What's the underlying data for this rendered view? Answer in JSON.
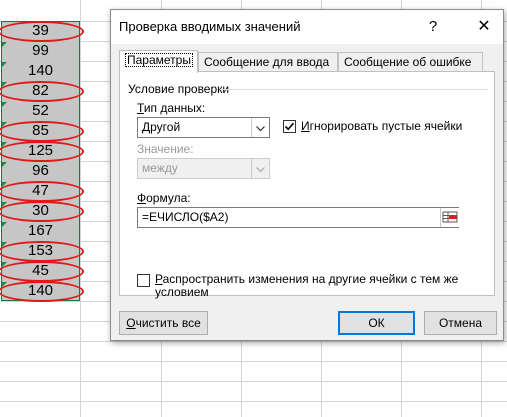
{
  "sheet": {
    "values": [
      "39",
      "99",
      "140",
      "82",
      "52",
      "85",
      "125",
      "96",
      "47",
      "30",
      "167",
      "153",
      "45",
      "140"
    ],
    "circled": [
      true,
      false,
      false,
      true,
      false,
      true,
      true,
      false,
      true,
      true,
      false,
      true,
      true,
      true
    ],
    "colors": {
      "selection": "#c6c6c6",
      "circle": "#e01818",
      "selection_border": "#217346"
    }
  },
  "dialog": {
    "title": "Проверка вводимых значений",
    "help_label": "?",
    "close_label": "✕",
    "tabs": [
      {
        "label": "Параметры",
        "active": true
      },
      {
        "label": "Сообщение для ввода",
        "active": false
      },
      {
        "label": "Сообщение об ошибке",
        "active": false
      }
    ],
    "group_title": "Условие проверки",
    "data_type_label_u": "Т",
    "data_type_label_rest": "ип данных:",
    "data_type_value": "Другой",
    "ignore_blank_label_u": "И",
    "ignore_blank_label_rest": "гнорировать пустые ячейки",
    "ignore_blank_checked": true,
    "operator_label": "Значение:",
    "operator_value": "между",
    "formula_label_u": "Ф",
    "formula_label_rest": "ормула:",
    "formula_value": "=ЕЧИСЛО($A2)",
    "apply_all_label_u": "Р",
    "apply_all_label_rest": "аспространить изменения на другие ячейки с тем же",
    "apply_all_label_line2": "условием",
    "apply_all_checked": false,
    "clear_all_u": "О",
    "clear_all_rest": "чистить все",
    "ok_label": "ОК",
    "cancel_label": "Отмена"
  }
}
